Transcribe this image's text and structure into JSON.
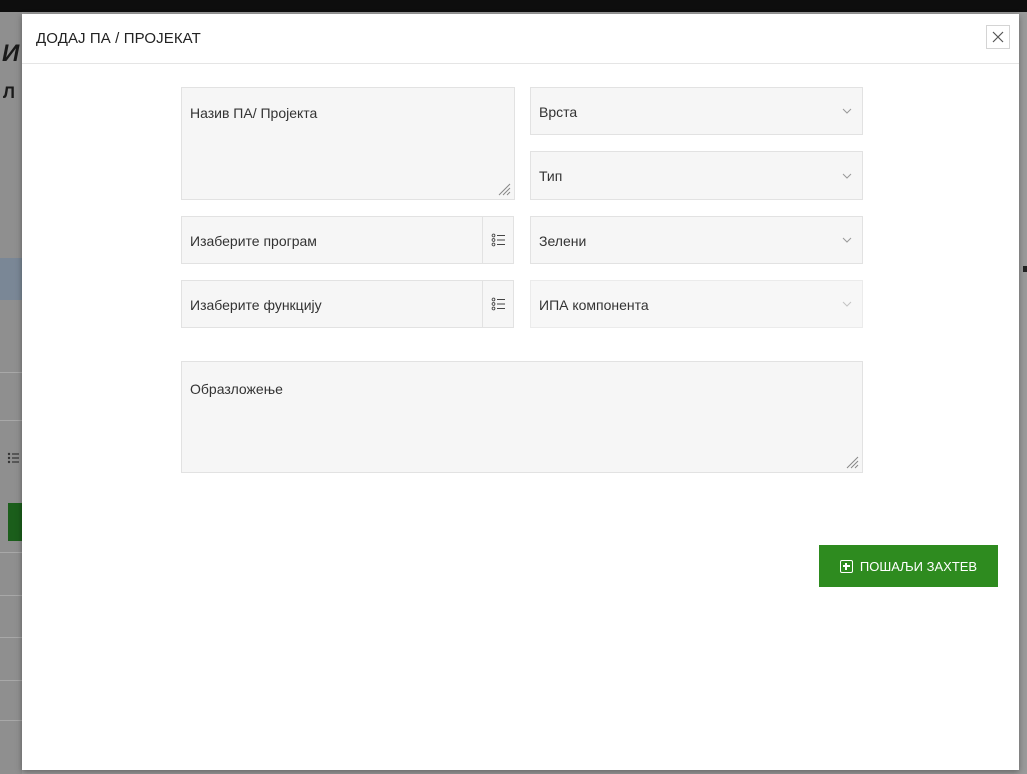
{
  "background": {
    "heading_fragment": "И",
    "subheading_fragment": "Л"
  },
  "modal": {
    "title": "ДОДАЈ ПА / ПРОЈЕКАТ",
    "fields": {
      "name": {
        "placeholder": "Назив ПА/ Пројекта"
      },
      "kind": {
        "label": "Врста"
      },
      "type": {
        "label": "Тип"
      },
      "program": {
        "label": "Изаберите програм"
      },
      "green": {
        "label": "Зелени"
      },
      "function": {
        "label": "Изаберите функцију"
      },
      "ipa_component": {
        "label": "ИПА компонента"
      },
      "justification": {
        "placeholder": "Образложење"
      }
    },
    "submit_label": "ПОШАЉИ ЗАХТЕВ"
  },
  "icons": {
    "close": "close-icon",
    "chevron": "chevron-down-icon",
    "list": "list-icon",
    "resize": "resize-handle-icon",
    "submit": "plus-square-icon"
  },
  "colors": {
    "accent_green": "#2e8b1f",
    "field_bg": "#f6f6f6",
    "field_border": "#e2e2e2"
  }
}
